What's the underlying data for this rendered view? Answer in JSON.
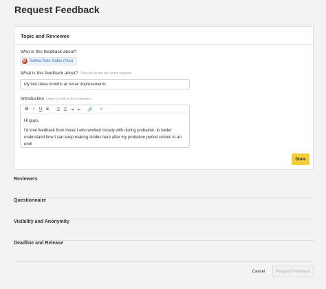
{
  "page": {
    "title": "Request Feedback"
  },
  "topic_card": {
    "header": "Topic and Reviewee",
    "who_label": "Who is this feedback about?",
    "reviewee_chip": "Salma from Sales (You)",
    "what_label": "What is this feedback about?",
    "what_hint": "This will be the title of the request",
    "title_value": "My first three months at Small Improvements",
    "intro_label": "Introduction",
    "intro_hint": "Leave a note to the reviewers",
    "toolbar": {
      "bold": "B",
      "italic": "I",
      "underline": "U",
      "strike": "S",
      "bullet_list": "☰",
      "numbered_list": "☰",
      "indent": "⇥",
      "outdent": "⇤",
      "link": "🔗",
      "emoji": "☺"
    },
    "intro_paragraphs": [
      "Hi guys,",
      "I'd love feedback from those I who worked closely with during probation, to better understand how I can keep making strides here after my probation period comes to an end!"
    ],
    "done_button": "Done"
  },
  "sections": [
    "Reviewers",
    "Questionnaire",
    "Visibility and Anonymity",
    "Deadline and Release"
  ],
  "footer": {
    "cancel_button": "Cancel",
    "request_button": "Request Feedback"
  },
  "colors": {
    "accent_yellow": "#f5cd3b",
    "chip_text": "#2f6eb5",
    "background": "#f3f3f3"
  }
}
